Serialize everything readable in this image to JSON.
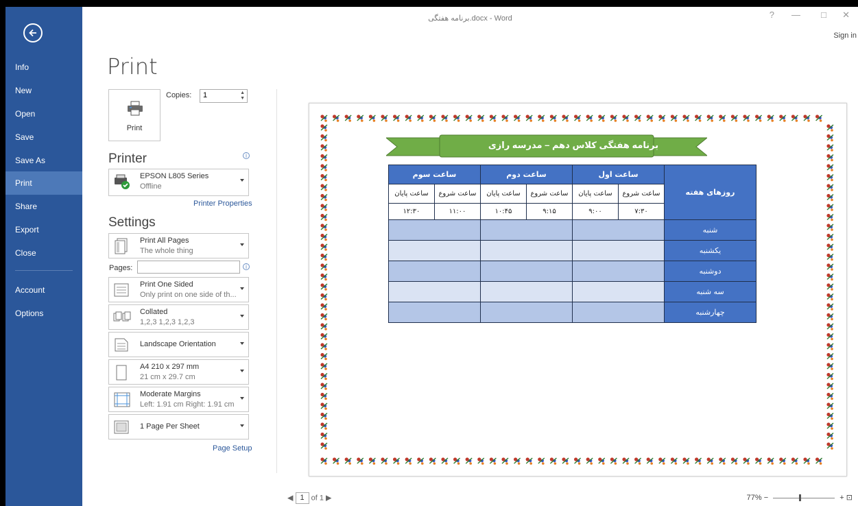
{
  "window": {
    "title": "برنامه هفتگی.docx - Word",
    "controls": [
      "?",
      "—",
      "□",
      "✕"
    ],
    "sign_in": "Sign in"
  },
  "nav": {
    "back": "back-arrow-icon",
    "items": [
      {
        "label": "Info"
      },
      {
        "label": "New"
      },
      {
        "label": "Open"
      },
      {
        "label": "Save"
      },
      {
        "label": "Save As"
      },
      {
        "label": "Print",
        "selected": true
      },
      {
        "label": "Share"
      },
      {
        "label": "Export"
      },
      {
        "label": "Close"
      }
    ],
    "bottom_items": [
      {
        "label": "Account"
      },
      {
        "label": "Options"
      }
    ],
    "color": "#2b579a",
    "selected_color": "#4d79b8"
  },
  "print": {
    "title": "Print",
    "button_label": "Print",
    "copies_label": "Copies:",
    "copies_value": "1",
    "printer_header": "Printer",
    "printer_name": "EPSON L805 Series",
    "printer_status": "Offline",
    "printer_properties": "Printer Properties",
    "settings_header": "Settings",
    "pages_label": "Pages:",
    "page_setup": "Page Setup",
    "settings": [
      {
        "line1": "Print All Pages",
        "line2": "The whole thing"
      },
      {
        "line1": "Print One Sided",
        "line2": "Only print on one side of th..."
      },
      {
        "line1": "Collated",
        "line2": "1,2,3   1,2,3   1,2,3"
      },
      {
        "line1": "Landscape Orientation"
      },
      {
        "line1": "A4 210 x 297 mm",
        "line2": "21 cm x 29.7 cm"
      },
      {
        "line1": "Moderate Margins",
        "line2": "Left: 1.91 cm   Right: 1.91 cm"
      },
      {
        "line1": "1 Page Per Sheet"
      }
    ]
  },
  "document": {
    "banner_title": "برنامه هفتگی کلاس دهم – مدرسه رازی",
    "banner_color": "#70ad47",
    "header_color": "#4472c4",
    "row_colors": [
      "#b4c6e7",
      "#dae3f3"
    ],
    "day_column_header": "روزهای هفته",
    "periods": [
      {
        "name": "ساعت اول",
        "start_label": "ساعت شروع",
        "end_label": "ساعت پایان",
        "start": "۷:۳۰",
        "end": "۹:۰۰"
      },
      {
        "name": "ساعت دوم",
        "start_label": "ساعت شروع",
        "end_label": "ساعت پایان",
        "start": "۹:۱۵",
        "end": "۱۰:۴۵"
      },
      {
        "name": "ساعت سوم",
        "start_label": "ساعت شروع",
        "end_label": "ساعت پایان",
        "start": "۱۱:۰۰",
        "end": "۱۲:۳۰"
      }
    ],
    "days": [
      "شنبه",
      "یکشنبه",
      "دوشنبه",
      "سه شنبه",
      "چهارشنبه"
    ]
  },
  "status": {
    "page_current": "1",
    "page_total": "of 1",
    "zoom": "77%"
  }
}
